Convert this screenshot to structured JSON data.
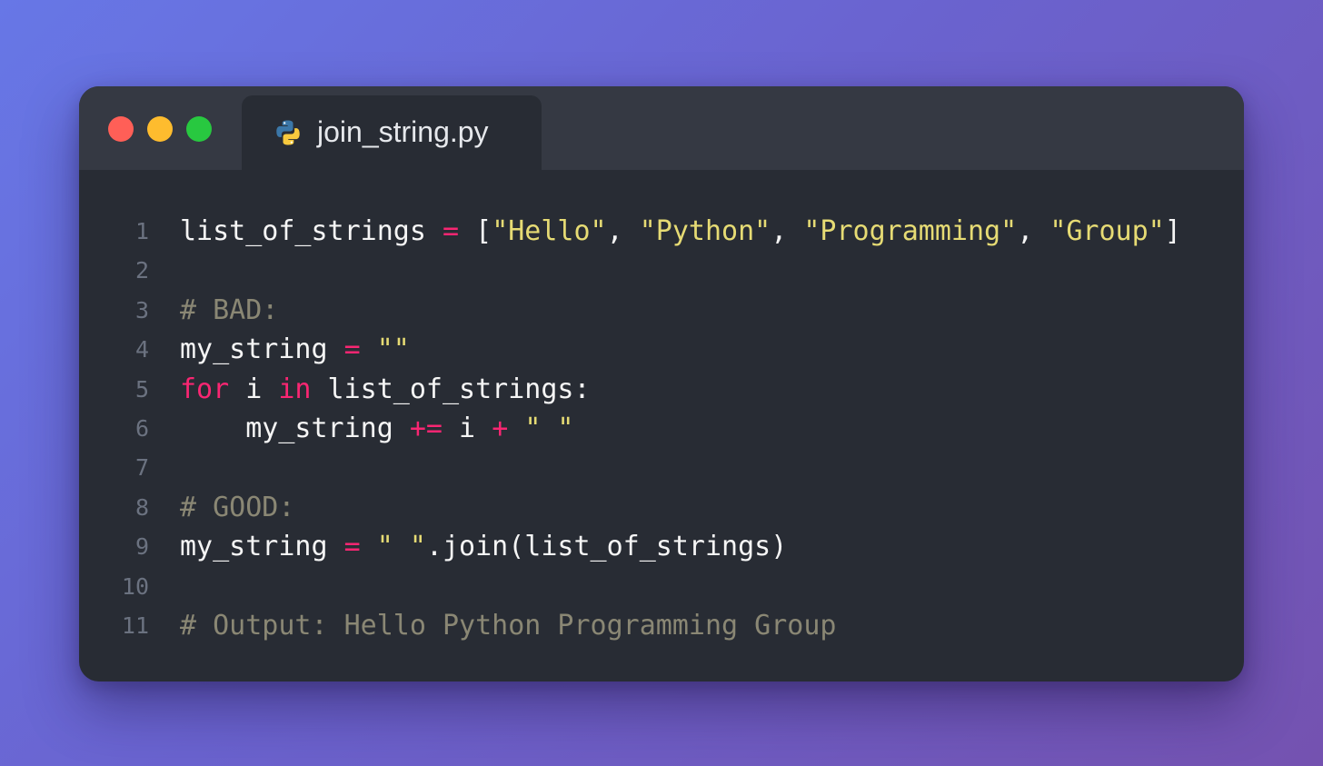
{
  "window": {
    "traffic_lights": [
      "close",
      "minimize",
      "zoom"
    ],
    "colors": {
      "close": "#ff5f57",
      "minimize": "#febc2e",
      "zoom": "#28c840"
    }
  },
  "tab": {
    "icon": "python-icon",
    "filename": "join_string.py"
  },
  "code": {
    "language": "python",
    "lines": [
      {
        "number": "1",
        "tokens": [
          {
            "t": "list_of_strings",
            "k": "id"
          },
          {
            "t": " ",
            "k": "id"
          },
          {
            "t": "=",
            "k": "op"
          },
          {
            "t": " [",
            "k": "punc"
          },
          {
            "t": "\"Hello\"",
            "k": "str"
          },
          {
            "t": ", ",
            "k": "punc"
          },
          {
            "t": "\"Python\"",
            "k": "str"
          },
          {
            "t": ", ",
            "k": "punc"
          },
          {
            "t": "\"Programming\"",
            "k": "str"
          },
          {
            "t": ", ",
            "k": "punc"
          },
          {
            "t": "\"Group\"",
            "k": "str"
          },
          {
            "t": "]",
            "k": "punc"
          }
        ]
      },
      {
        "number": "2",
        "tokens": []
      },
      {
        "number": "3",
        "tokens": [
          {
            "t": "# BAD:",
            "k": "cm"
          }
        ]
      },
      {
        "number": "4",
        "tokens": [
          {
            "t": "my_string",
            "k": "id"
          },
          {
            "t": " ",
            "k": "id"
          },
          {
            "t": "=",
            "k": "op"
          },
          {
            "t": " ",
            "k": "id"
          },
          {
            "t": "\"\"",
            "k": "str"
          }
        ]
      },
      {
        "number": "5",
        "tokens": [
          {
            "t": "for",
            "k": "kw"
          },
          {
            "t": " i ",
            "k": "id"
          },
          {
            "t": "in",
            "k": "kw"
          },
          {
            "t": " list_of_strings:",
            "k": "id"
          }
        ]
      },
      {
        "number": "6",
        "tokens": [
          {
            "t": "    my_string ",
            "k": "id"
          },
          {
            "t": "+=",
            "k": "op"
          },
          {
            "t": " i ",
            "k": "id"
          },
          {
            "t": "+",
            "k": "op"
          },
          {
            "t": " ",
            "k": "id"
          },
          {
            "t": "\" \"",
            "k": "str"
          }
        ]
      },
      {
        "number": "7",
        "tokens": []
      },
      {
        "number": "8",
        "tokens": [
          {
            "t": "# GOOD:",
            "k": "cm"
          }
        ]
      },
      {
        "number": "9",
        "tokens": [
          {
            "t": "my_string",
            "k": "id"
          },
          {
            "t": " ",
            "k": "id"
          },
          {
            "t": "=",
            "k": "op"
          },
          {
            "t": " ",
            "k": "id"
          },
          {
            "t": "\" \"",
            "k": "str"
          },
          {
            "t": ".join(list_of_strings)",
            "k": "id"
          }
        ]
      },
      {
        "number": "10",
        "tokens": []
      },
      {
        "number": "11",
        "tokens": [
          {
            "t": "# Output: Hello Python Programming Group",
            "k": "cm"
          }
        ]
      }
    ]
  }
}
